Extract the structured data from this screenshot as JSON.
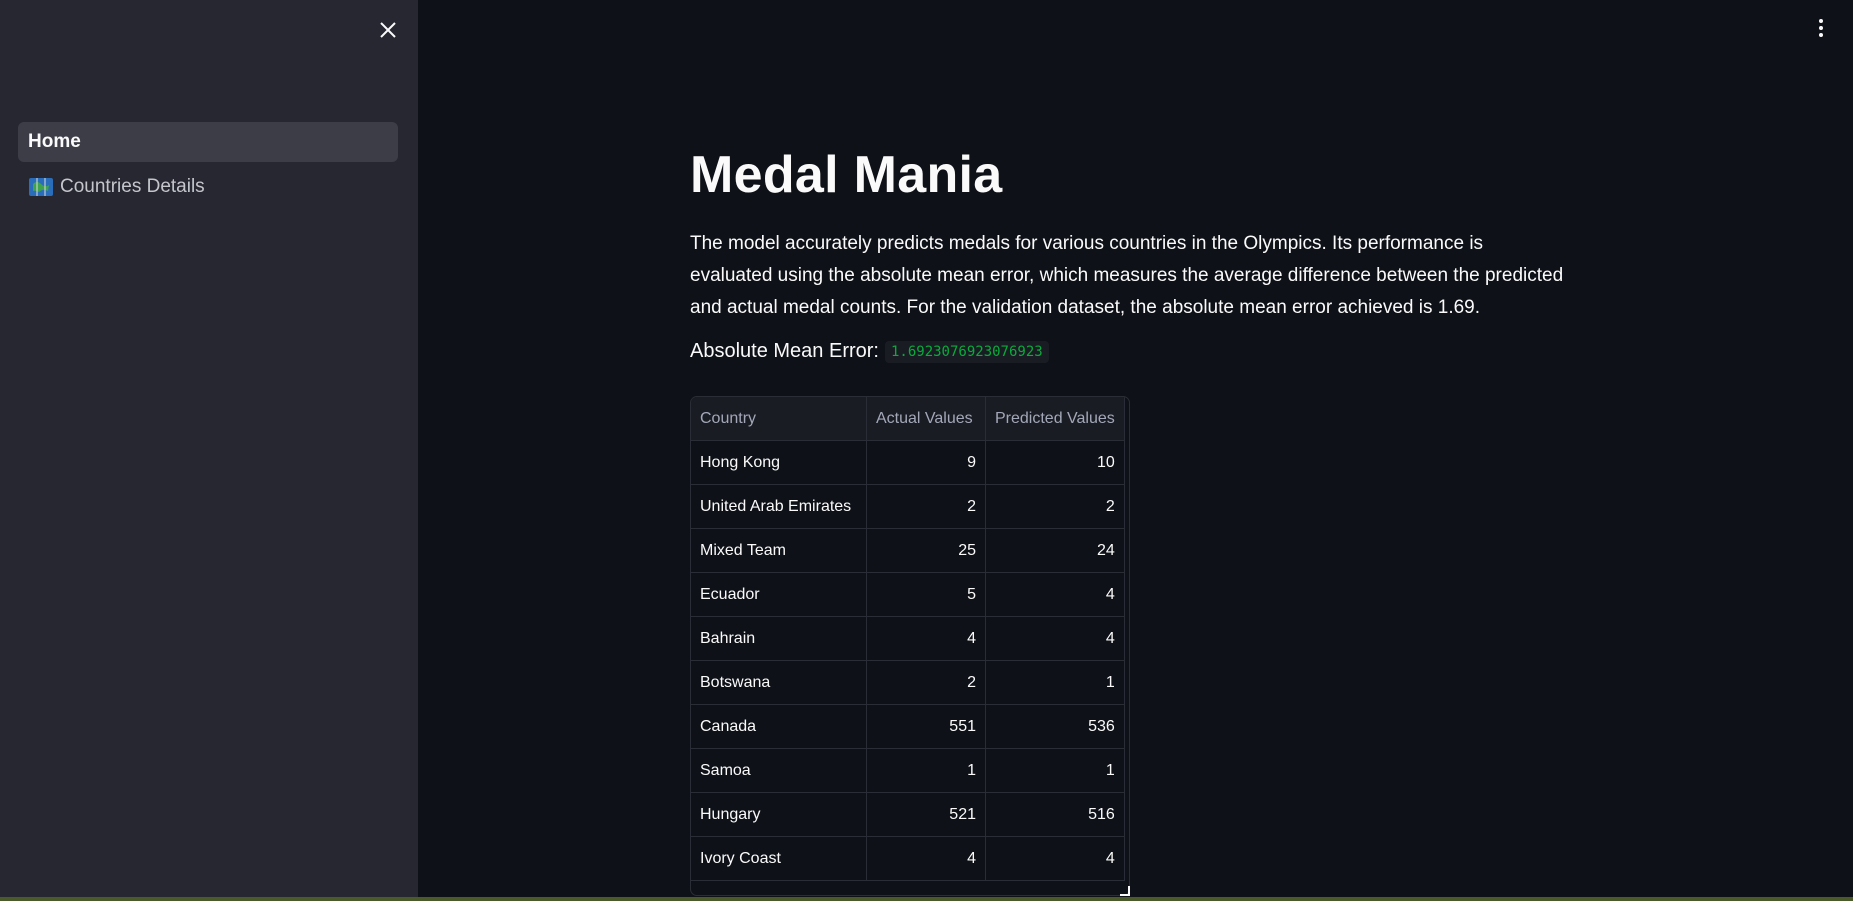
{
  "sidebar": {
    "close_icon": "close-icon",
    "items": [
      {
        "label": "Home",
        "active": true
      },
      {
        "label": "Countries Details",
        "active": false,
        "icon": "map-icon"
      }
    ]
  },
  "main": {
    "menu_icon": "vertical-dots-icon",
    "title": "Medal Mania",
    "description": "The model accurately predicts medals for various countries in the Olympics. Its performance is evaluated using the absolute mean error, which measures the average difference between the predicted and actual medal counts. For the validation dataset, the absolute mean error achieved is 1.69.",
    "mae_label": "Absolute Mean Error:",
    "mae_value": "1.6923076923076923"
  },
  "table": {
    "headers": [
      "Country",
      "Actual Values",
      "Predicted Values"
    ],
    "rows": [
      [
        "Hong Kong",
        "9",
        "10"
      ],
      [
        "United Arab Emirates",
        "2",
        "2"
      ],
      [
        "Mixed Team",
        "25",
        "24"
      ],
      [
        "Ecuador",
        "5",
        "4"
      ],
      [
        "Bahrain",
        "4",
        "4"
      ],
      [
        "Botswana",
        "2",
        "1"
      ],
      [
        "Canada",
        "551",
        "536"
      ],
      [
        "Samoa",
        "1",
        "1"
      ],
      [
        "Hungary",
        "521",
        "516"
      ],
      [
        "Ivory Coast",
        "4",
        "4"
      ]
    ]
  },
  "colors": {
    "background": "#0e1117",
    "sidebar": "#262730",
    "code_green": "#09ab3b"
  }
}
